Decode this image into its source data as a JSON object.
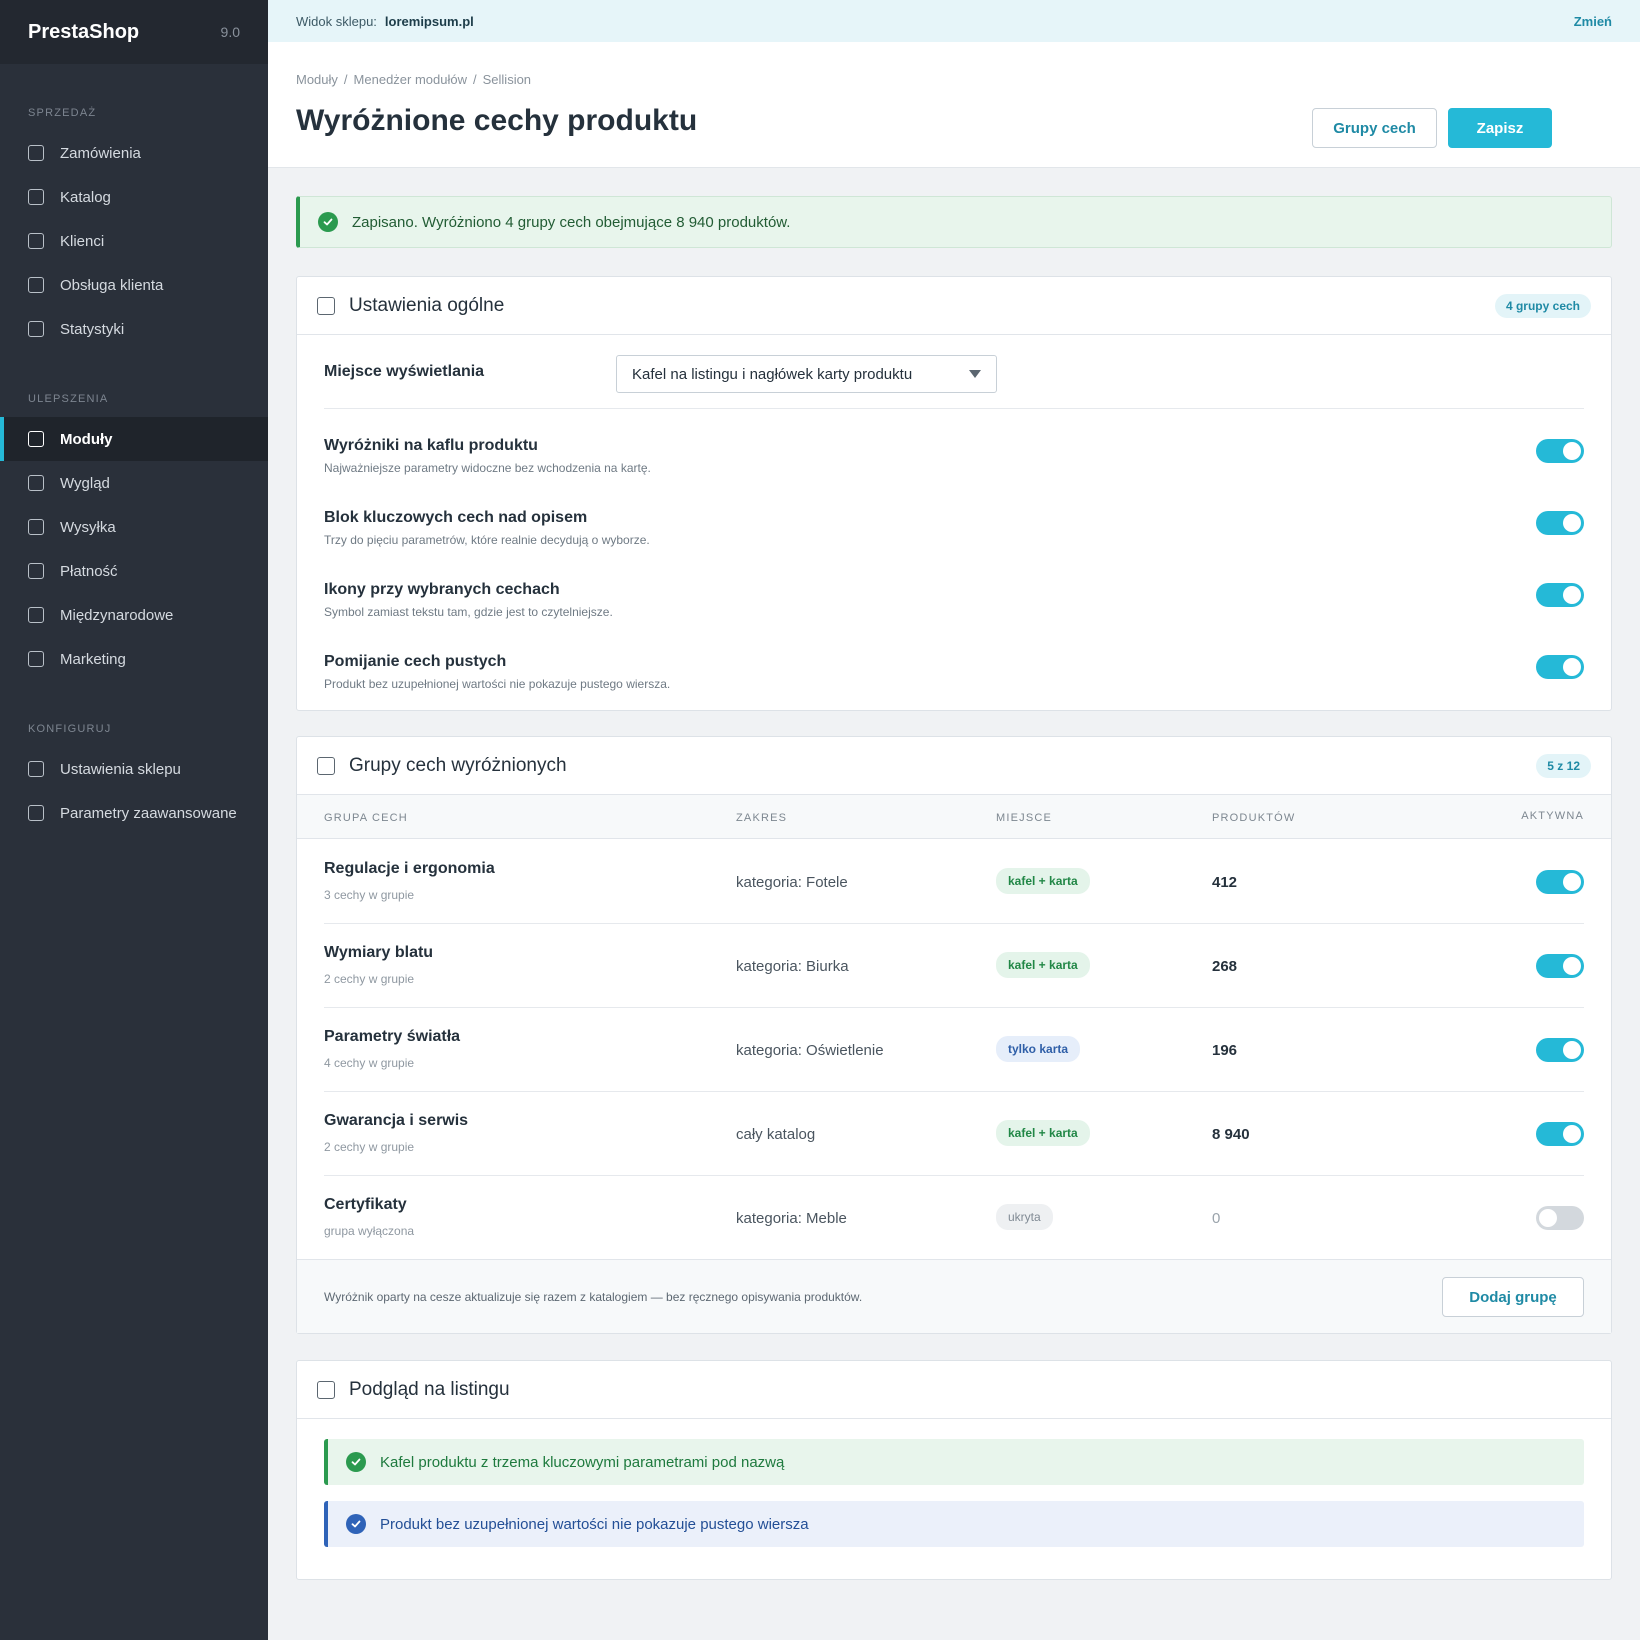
{
  "brand": {
    "name": "PrestaShop",
    "version": "9.0"
  },
  "sidebar": {
    "sections": [
      {
        "title": "SPRZEDAŻ",
        "items": [
          "Zamówienia",
          "Katalog",
          "Klienci",
          "Obsługa klienta",
          "Statystyki"
        ]
      },
      {
        "title": "ULEPSZENIA",
        "items": [
          "Moduły",
          "Wygląd",
          "Wysyłka",
          "Płatność",
          "Międzynarodowe",
          "Marketing"
        ]
      },
      {
        "title": "KONFIGURUJ",
        "items": [
          "Ustawienia sklepu",
          "Parametry zaawansowane"
        ]
      }
    ],
    "active_item": "Moduły"
  },
  "topbar": {
    "label": "Widok sklepu:",
    "store": "loremipsum.pl",
    "change": "Zmień"
  },
  "header": {
    "breadcrumb": [
      "Moduły",
      "Menedżer modułów",
      "Sellision"
    ],
    "title": "Wyróżnione cechy produktu",
    "btn_groups": "Grupy cech",
    "btn_save": "Zapisz"
  },
  "alert": {
    "text": "Zapisano. Wyróżniono 4 grupy cech obejmujące 8 940 produktów."
  },
  "general": {
    "title": "Ustawienia ogólne",
    "badge": "4 grupy cech",
    "display_label": "Miejsce wyświetlania",
    "display_value": "Kafel na listingu i nagłówek karty produktu",
    "settings": [
      {
        "label": "Wyróżniki na kaflu produktu",
        "desc": "Najważniejsze parametry widoczne bez wchodzenia na kartę.",
        "on": true
      },
      {
        "label": "Blok kluczowych cech nad opisem",
        "desc": "Trzy do pięciu parametrów, które realnie decydują o wyborze.",
        "on": true
      },
      {
        "label": "Ikony przy wybranych cechach",
        "desc": "Symbol zamiast tekstu tam, gdzie jest to czytelniejsze.",
        "on": true
      },
      {
        "label": "Pomijanie cech pustych",
        "desc": "Produkt bez uzupełnionej wartości nie pokazuje pustego wiersza.",
        "on": true
      }
    ]
  },
  "groups": {
    "title": "Grupy cech wyróżnionych",
    "badge": "5 z 12",
    "columns": [
      "GRUPA CECH",
      "ZAKRES",
      "MIEJSCE",
      "PRODUKTÓW",
      "AKTYWNA"
    ],
    "rows": [
      {
        "name": "Regulacje i ergonomia",
        "sub": "3 cechy w grupie",
        "scope": "kategoria: Fotele",
        "place": "kafel + karta",
        "place_style": "green",
        "count": "412",
        "active": true
      },
      {
        "name": "Wymiary blatu",
        "sub": "2 cechy w grupie",
        "scope": "kategoria: Biurka",
        "place": "kafel + karta",
        "place_style": "green",
        "count": "268",
        "active": true
      },
      {
        "name": "Parametry światła",
        "sub": "4 cechy w grupie",
        "scope": "kategoria: Oświetlenie",
        "place": "tylko karta",
        "place_style": "blue",
        "count": "196",
        "active": true
      },
      {
        "name": "Gwarancja i serwis",
        "sub": "2 cechy w grupie",
        "scope": "cały katalog",
        "place": "kafel + karta",
        "place_style": "green",
        "count": "8 940",
        "active": true
      },
      {
        "name": "Certyfikaty",
        "sub": "grupa wyłączona",
        "scope": "kategoria: Meble",
        "place": "ukryta",
        "place_style": "gray",
        "count": "0",
        "active": false
      }
    ],
    "footer_text": "Wyróżnik oparty na cesze aktualizuje się razem z katalogiem — bez ręcznego opisywania produktów.",
    "add_button": "Dodaj grupę"
  },
  "preview": {
    "title": "Podgląd na listingu",
    "notices": [
      {
        "text": "Kafel produktu z trzema kluczowymi parametrami pod nazwą",
        "style": "green"
      },
      {
        "text": "Produkt bez uzupełnionej wartości nie pokazuje pustego wiersza",
        "style": "blue"
      }
    ]
  },
  "colors": {
    "accent": "#25b9d7",
    "sidebar": "#2a303a",
    "success": "#2b9a4f",
    "info": "#2f63b8"
  }
}
